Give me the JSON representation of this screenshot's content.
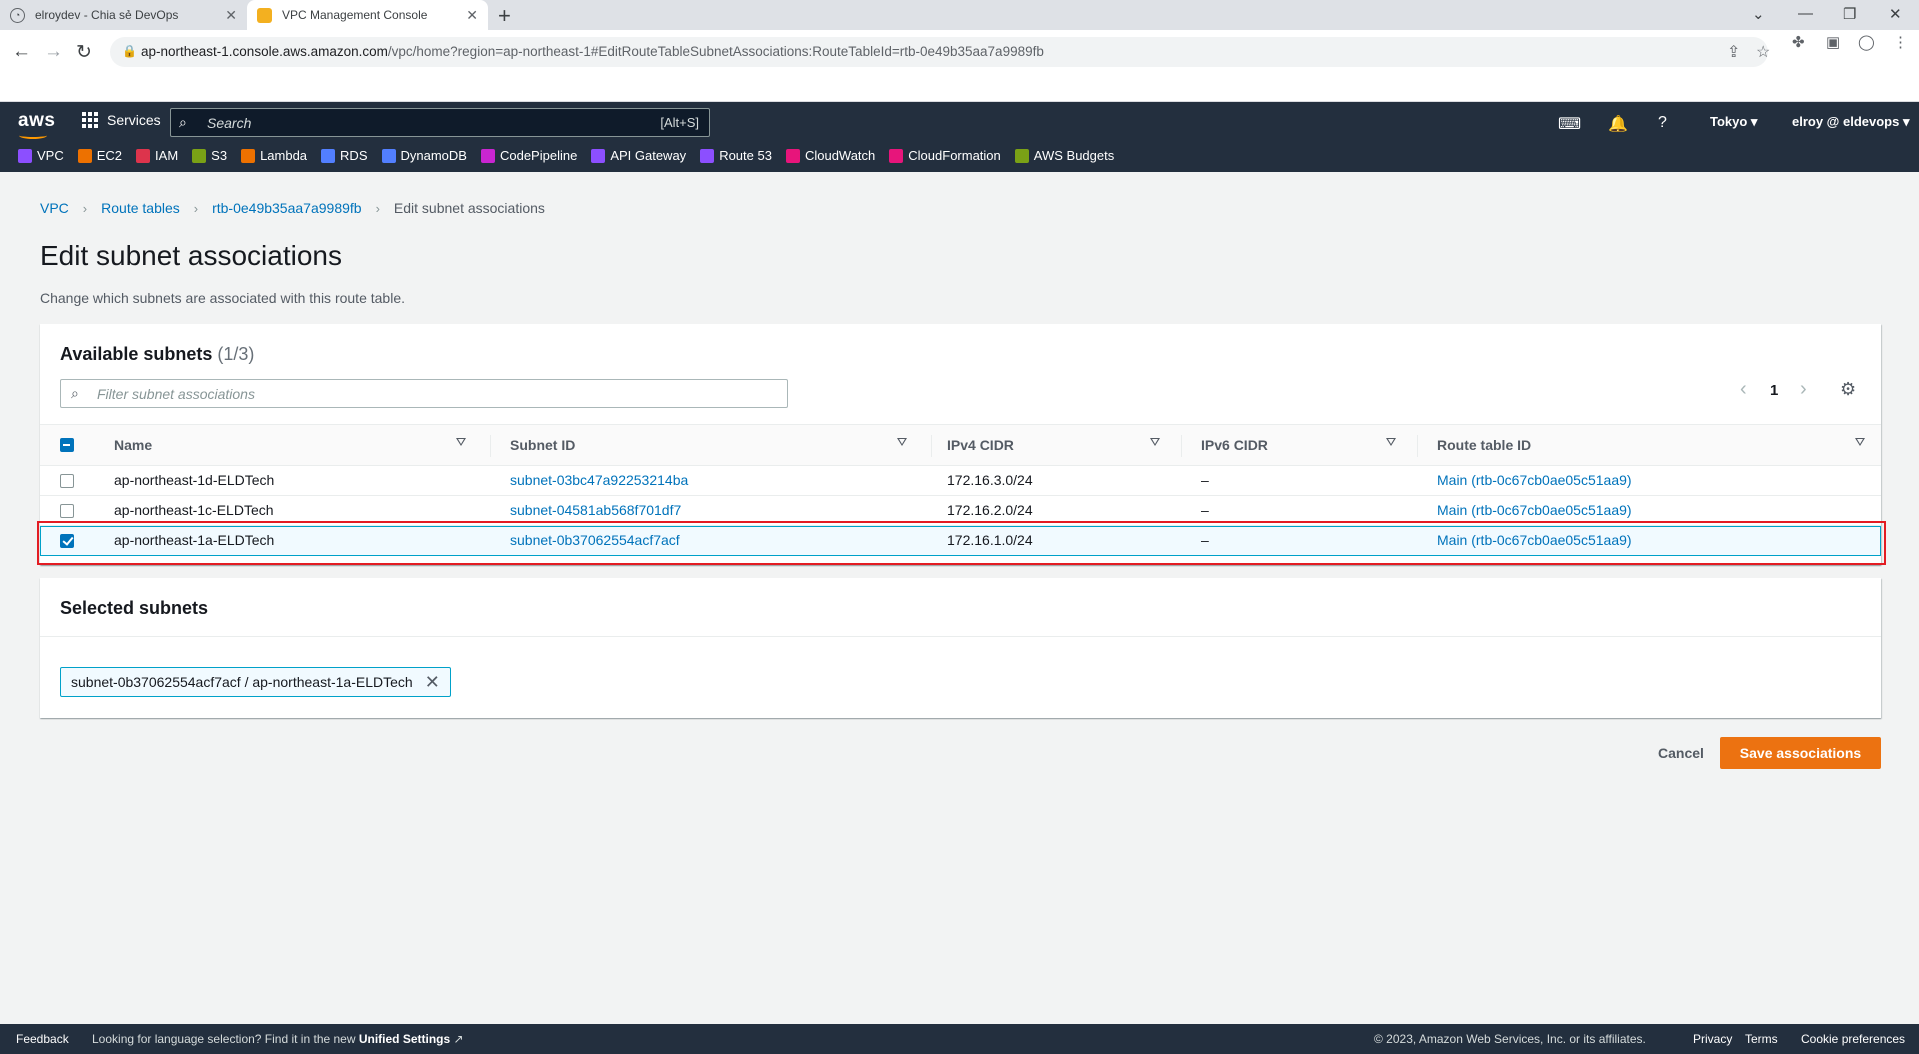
{
  "browser": {
    "tabs": [
      {
        "title": "elroydev - Chia sẻ DevOps",
        "active": false
      },
      {
        "title": "VPC Management Console",
        "active": true
      }
    ],
    "url_host": "ap-northeast-1.console.aws.amazon.com",
    "url_path": "/vpc/home?region=ap-northeast-1#EditRouteTableSubnetAssociations:RouteTableId=rtb-0e49b35aa7a9989fb"
  },
  "aws_header": {
    "logo": "aws",
    "services_label": "Services",
    "search_placeholder": "Search",
    "search_shortcut": "[Alt+S]",
    "region": "Tokyo ▾",
    "account": "elroy @ eldevops ▾",
    "favorites": [
      {
        "label": "VPC",
        "color": "#8c4fff"
      },
      {
        "label": "EC2",
        "color": "#ed7100"
      },
      {
        "label": "IAM",
        "color": "#dd344c"
      },
      {
        "label": "S3",
        "color": "#7aa116"
      },
      {
        "label": "Lambda",
        "color": "#ed7100"
      },
      {
        "label": "RDS",
        "color": "#527fff"
      },
      {
        "label": "DynamoDB",
        "color": "#527fff"
      },
      {
        "label": "CodePipeline",
        "color": "#c925d1"
      },
      {
        "label": "API Gateway",
        "color": "#8c4fff"
      },
      {
        "label": "Route 53",
        "color": "#8c4fff"
      },
      {
        "label": "CloudWatch",
        "color": "#e7157b"
      },
      {
        "label": "CloudFormation",
        "color": "#e7157b"
      },
      {
        "label": "AWS Budgets",
        "color": "#7aa116"
      }
    ]
  },
  "breadcrumb": {
    "items": [
      "VPC",
      "Route tables",
      "rtb-0e49b35aa7a9989fb"
    ],
    "current": "Edit subnet associations"
  },
  "page": {
    "title": "Edit subnet associations",
    "description": "Change which subnets are associated with this route table."
  },
  "available": {
    "heading": "Available subnets",
    "count": "(1/3)",
    "filter_placeholder": "Filter subnet associations",
    "page_number": "1",
    "columns": [
      "Name",
      "Subnet ID",
      "IPv4 CIDR",
      "IPv6 CIDR",
      "Route table ID"
    ],
    "rows": [
      {
        "name": "ap-northeast-1d-ELDTech",
        "subnet_id": "subnet-03bc47a92253214ba",
        "ipv4": "172.16.3.0/24",
        "ipv6": "–",
        "route_table": "Main (rtb-0c67cb0ae05c51aa9)",
        "checked": false
      },
      {
        "name": "ap-northeast-1c-ELDTech",
        "subnet_id": "subnet-04581ab568f701df7",
        "ipv4": "172.16.2.0/24",
        "ipv6": "–",
        "route_table": "Main (rtb-0c67cb0ae05c51aa9)",
        "checked": false
      },
      {
        "name": "ap-northeast-1a-ELDTech",
        "subnet_id": "subnet-0b37062554acf7acf",
        "ipv4": "172.16.1.0/24",
        "ipv6": "–",
        "route_table": "Main (rtb-0c67cb0ae05c51aa9)",
        "checked": true
      }
    ]
  },
  "selected": {
    "heading": "Selected subnets",
    "tokens": [
      "subnet-0b37062554acf7acf / ap-northeast-1a-ELDTech"
    ]
  },
  "actions": {
    "cancel": "Cancel",
    "save": "Save associations"
  },
  "footer": {
    "feedback": "Feedback",
    "lang_prefix": "Looking for language selection? Find it in the new ",
    "lang_link": "Unified Settings",
    "copyright": "© 2023, Amazon Web Services, Inc. or its affiliates.",
    "privacy": "Privacy",
    "terms": "Terms",
    "cookies": "Cookie preferences"
  },
  "colors": {
    "accent": "#ec7211",
    "link": "#0073bb",
    "nav_bg": "#232f3e",
    "highlight": "#e31c23"
  }
}
